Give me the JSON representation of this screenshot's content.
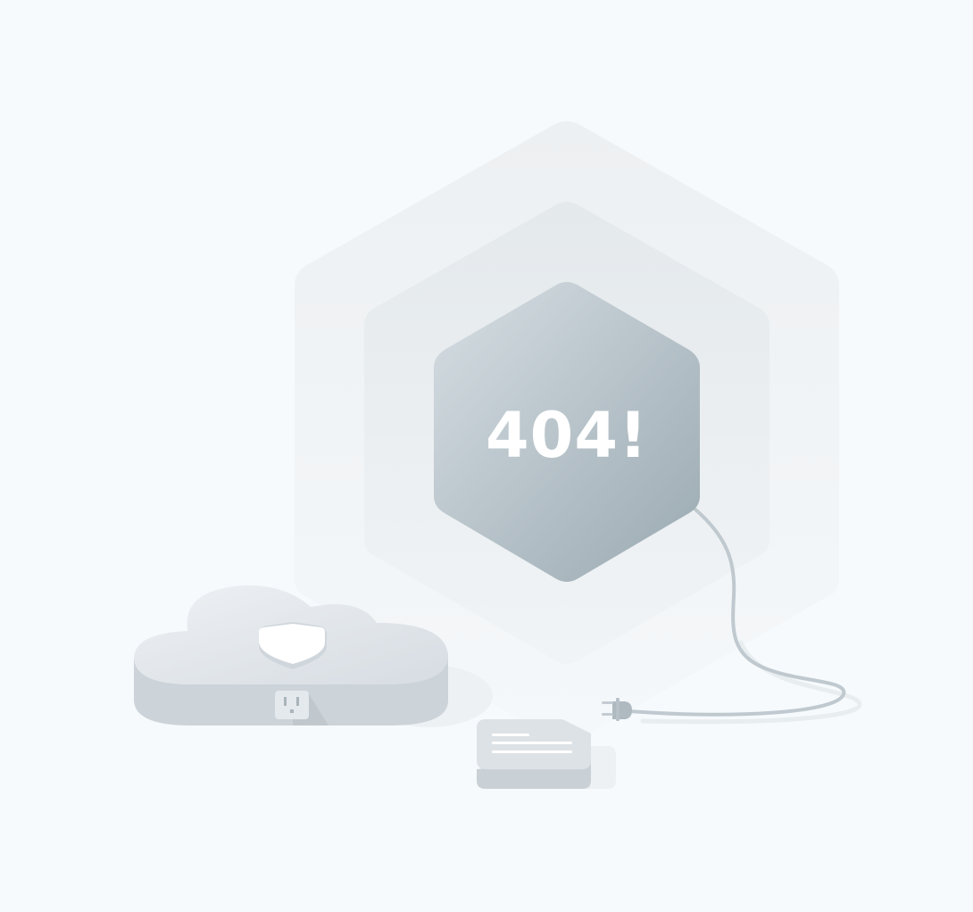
{
  "error": {
    "code_text": "404!"
  },
  "colors": {
    "background": "#f6fafc",
    "hex_outer": "#eef1f3",
    "hex_middle": "#e6eaed",
    "hex_inner_light": "#d3dbe0",
    "hex_inner_dark": "#9eadb5",
    "code_text": "#ffffff",
    "cloud_top": "#e7ebef",
    "cloud_side": "#ccd3d9",
    "cable": "#bfc9cf",
    "card_top": "#dde2e6",
    "card_side": "#c9d0d5"
  },
  "icons": {
    "hexagon_badge": "hexagon-badge-icon",
    "cloud_server": "cloud-server-icon",
    "shield": "shield-icon",
    "power_outlet": "power-outlet-icon",
    "power_plug": "power-plug-icon",
    "document_card": "document-card-icon"
  }
}
